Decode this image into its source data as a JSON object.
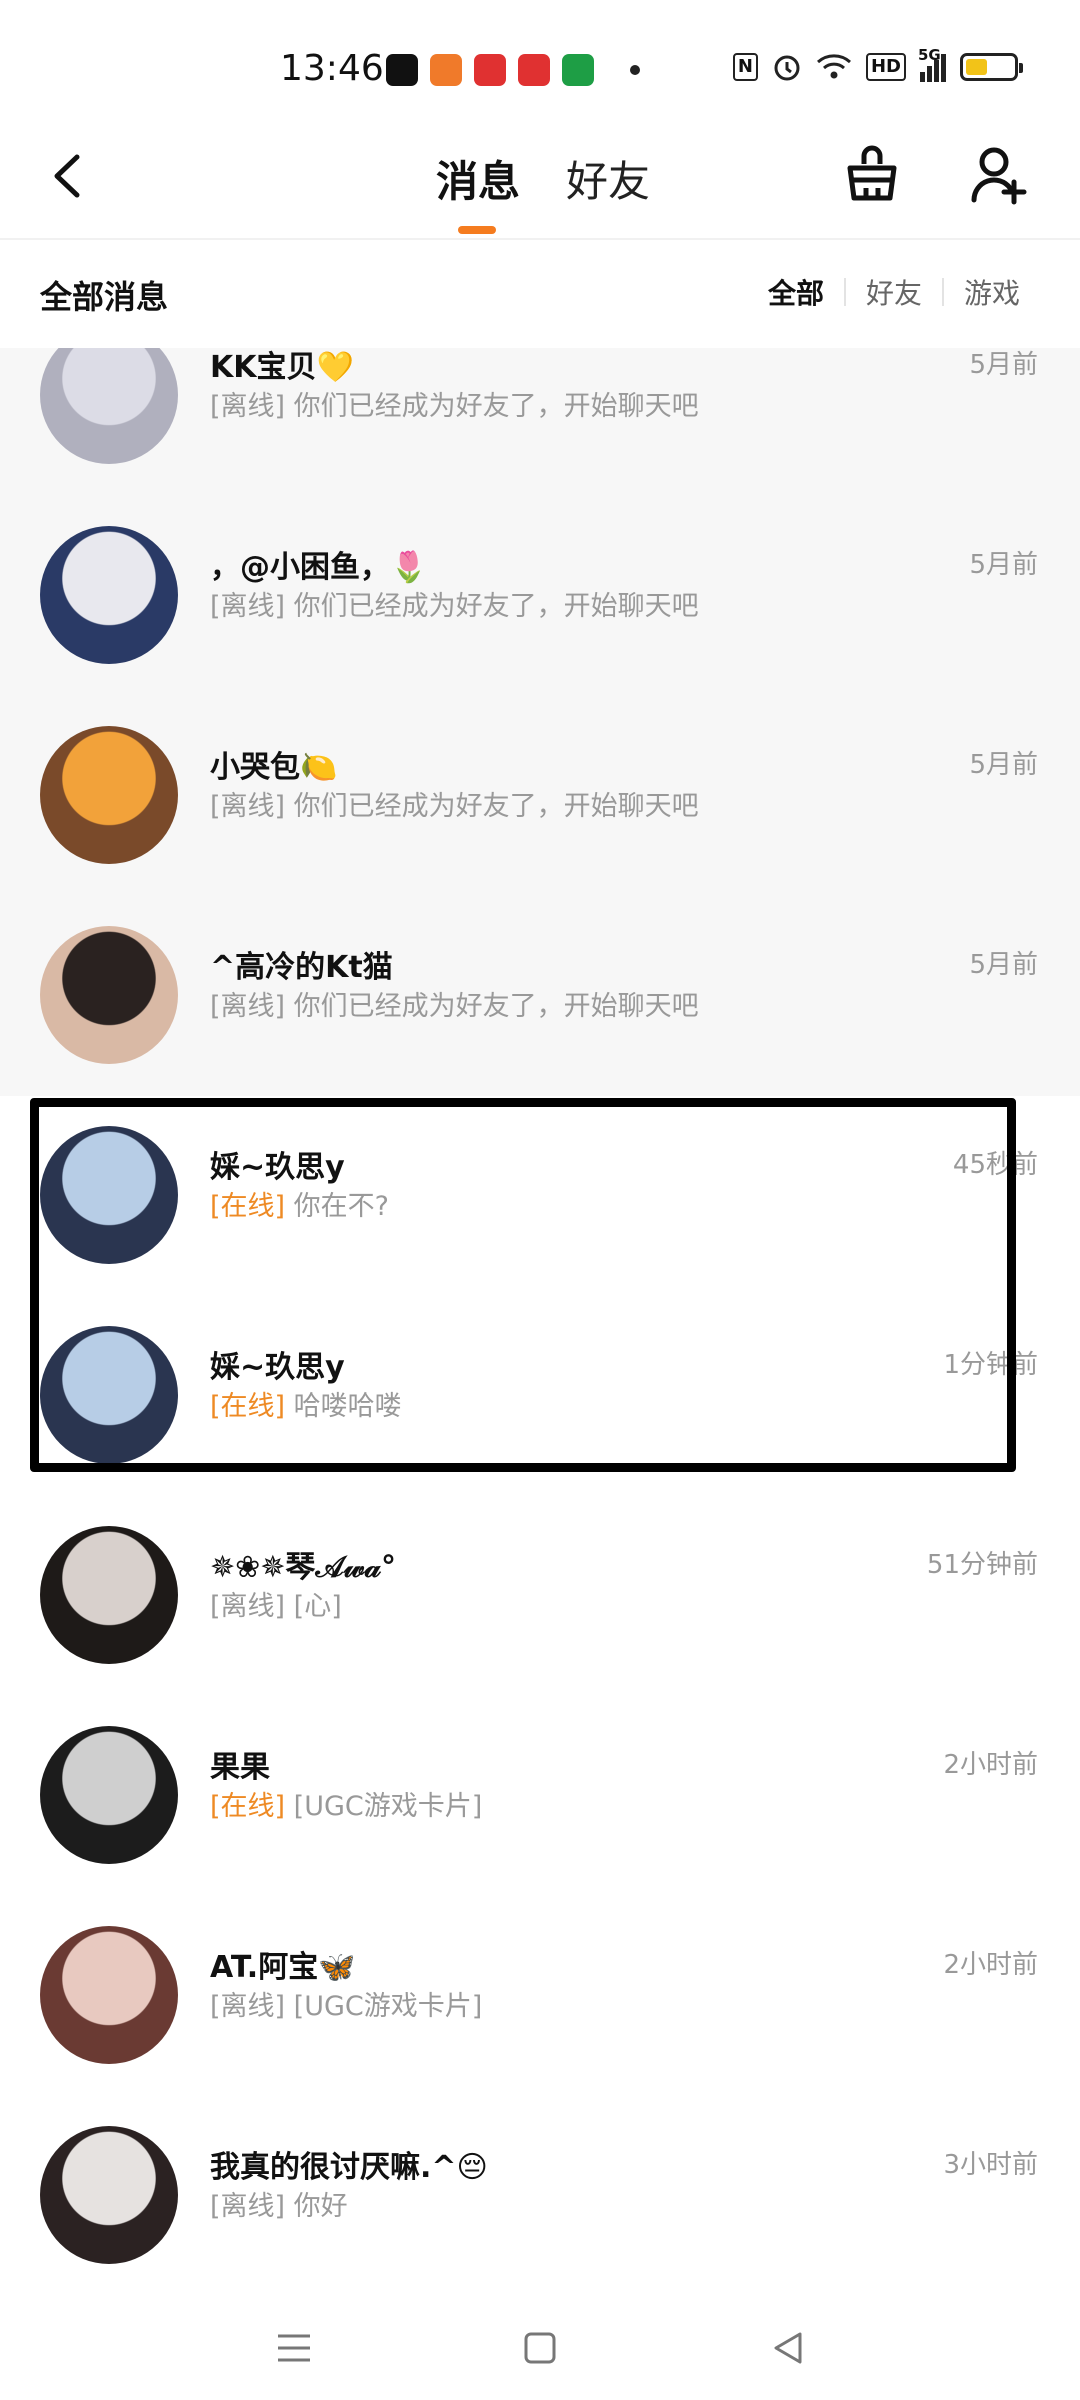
{
  "status_bar": {
    "time": "13:46",
    "apps": [
      {
        "icon": "tiktok-icon",
        "color": "#111111"
      },
      {
        "icon": "app-grid-icon",
        "color": "#f07a2a"
      },
      {
        "icon": "toutiao-icon",
        "color": "#e03131"
      },
      {
        "icon": "record-icon",
        "color": "#e03131"
      },
      {
        "icon": "oppo-store-icon",
        "color": "#1e9e45"
      }
    ],
    "nfc": "N",
    "hd": "HD",
    "network": "5G",
    "battery_level": 0.45
  },
  "header": {
    "tabs": [
      "消息",
      "好友"
    ],
    "active_tab": 0,
    "accent_color": "#f57c1f"
  },
  "filter_bar": {
    "title": "全部消息",
    "filters": [
      "全部",
      "好友",
      "游戏"
    ],
    "active_filter": 0
  },
  "messages": [
    {
      "name": "KK宝贝💛",
      "status": "[离线]",
      "online": false,
      "preview": "你们已经成为好友了，开始聊天吧",
      "time": "5月前",
      "read": true,
      "avatar_colors": [
        "#dcdce6",
        "#b0b0be"
      ]
    },
    {
      "name": "，@小困鱼，🌷",
      "status": "[离线]",
      "online": false,
      "preview": "你们已经成为好友了，开始聊天吧",
      "time": "5月前",
      "read": true,
      "avatar_colors": [
        "#e8e8ee",
        "#2a3a66"
      ]
    },
    {
      "name": "小哭包🍋",
      "status": "[离线]",
      "online": false,
      "preview": "你们已经成为好友了，开始聊天吧",
      "time": "5月前",
      "read": true,
      "avatar_colors": [
        "#f2a23a",
        "#7a4a2a"
      ]
    },
    {
      "name": "^高冷的Kt猫",
      "status": "[离线]",
      "online": false,
      "preview": "你们已经成为好友了，开始聊天吧",
      "time": "5月前",
      "read": true,
      "avatar_colors": [
        "#2a2220",
        "#d9b9a5"
      ]
    },
    {
      "name": "婇~玖思y",
      "status": "[在线]",
      "online": true,
      "preview": "你在不?",
      "time": "45秒前",
      "read": false,
      "avatar_colors": [
        "#b7cde6",
        "#2a3550"
      ]
    },
    {
      "name": "婇~玖思y",
      "status": "[在线]",
      "online": true,
      "preview": "哈喽哈喽",
      "time": "1分钟前",
      "read": false,
      "avatar_colors": [
        "#b7cde6",
        "#2a3550"
      ]
    },
    {
      "name": "✵❀✵琴𝒜𝓌𝒶°",
      "status": "[离线]",
      "online": false,
      "preview": "[心]",
      "time": "51分钟前",
      "read": false,
      "avatar_colors": [
        "#d8d0cc",
        "#1e1a18"
      ]
    },
    {
      "name": "果果",
      "status": "[在线]",
      "online": true,
      "preview": "[UGC游戏卡片]",
      "time": "2小时前",
      "read": false,
      "avatar_colors": [
        "#cfcfcf",
        "#1c1c1c"
      ]
    },
    {
      "name": "AT.阿宝🦋",
      "status": "[离线]",
      "online": false,
      "preview": "[UGC游戏卡片]",
      "time": "2小时前",
      "read": false,
      "avatar_colors": [
        "#e8c9c0",
        "#6a3a33"
      ]
    },
    {
      "name": "我真的很讨厌嘛.^😔",
      "status": "[离线]",
      "online": false,
      "preview": "你好",
      "time": "3小时前",
      "read": false,
      "avatar_colors": [
        "#e6e2e0",
        "#2b2222"
      ]
    }
  ]
}
